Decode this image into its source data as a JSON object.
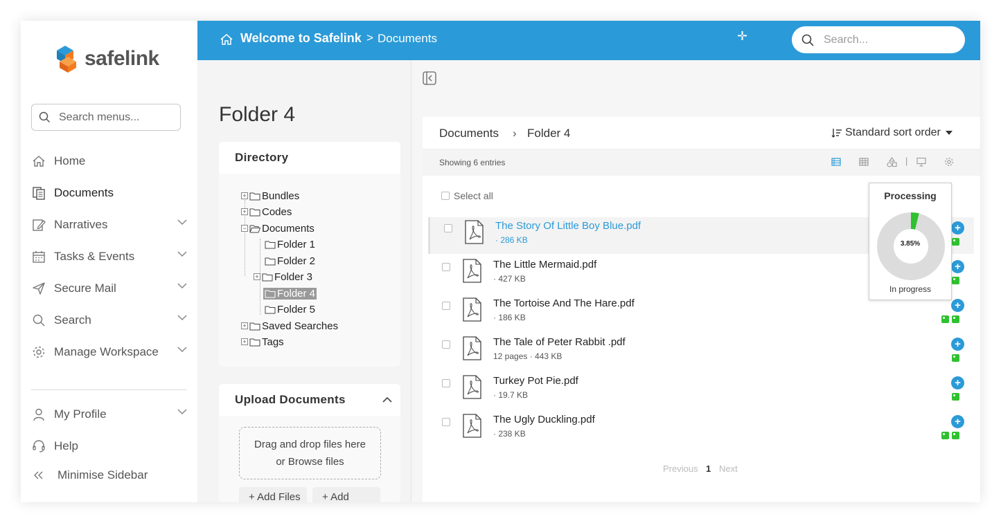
{
  "app": {
    "brand": "safelink"
  },
  "sidebar": {
    "search_placeholder": "Search menus...",
    "items": [
      {
        "label": "Home",
        "icon": "home-icon"
      },
      {
        "label": "Documents",
        "icon": "documents-icon"
      },
      {
        "label": "Narratives",
        "icon": "narratives-icon"
      },
      {
        "label": "Tasks & Events",
        "icon": "calendar-icon"
      },
      {
        "label": "Secure Mail",
        "icon": "paper-plane-icon"
      },
      {
        "label": "Search",
        "icon": "search-icon"
      },
      {
        "label": "Manage Workspace",
        "icon": "gear-icon"
      }
    ],
    "bottom_items": [
      {
        "label": "My Profile",
        "icon": "user-icon"
      },
      {
        "label": "Help",
        "icon": "headset-icon"
      },
      {
        "label": "Minimise Sidebar",
        "icon": "double-chevron-left-icon"
      }
    ]
  },
  "topbar": {
    "title": "Welcome to Safelink",
    "separator": ">",
    "crumb": "Documents",
    "search_placeholder": "Search...",
    "accent": "#2b9ad8"
  },
  "folder_title": "Folder 4",
  "directory": {
    "heading": "Directory",
    "nodes": [
      {
        "label": "Bundles"
      },
      {
        "label": "Codes"
      },
      {
        "label": "Documents"
      },
      {
        "label": "Folder 1"
      },
      {
        "label": "Folder 2"
      },
      {
        "label": "Folder 3"
      },
      {
        "label": "Folder 4"
      },
      {
        "label": "Folder 5"
      },
      {
        "label": "Saved Searches"
      },
      {
        "label": "Tags"
      }
    ]
  },
  "upload": {
    "heading": "Upload Documents",
    "dropzone_line1": "Drag and drop files here",
    "dropzone_line2": "or Browse files",
    "add_files": "+  Add Files",
    "add_folder": "+  Add Folder"
  },
  "main": {
    "breadcrumb_root": "Documents",
    "breadcrumb_sep": "›",
    "breadcrumb_current": "Folder 4",
    "sort_label": "Standard sort order",
    "showing_prefix": "Showing ",
    "showing_count": "6",
    "showing_suffix": " entries",
    "select_all": "Select all",
    "files": [
      {
        "name": "The Story Of Little Boy Blue.pdf",
        "meta": "· 286 KB"
      },
      {
        "name": "The Little Mermaid.pdf",
        "meta": "· 427 KB"
      },
      {
        "name": "The Tortoise And The Hare.pdf",
        "meta": "· 186 KB"
      },
      {
        "name": "The Tale of Peter Rabbit .pdf",
        "meta": "12 pages · 443 KB"
      },
      {
        "name": "Turkey Pot Pie.pdf",
        "meta": "· 19.7 KB"
      },
      {
        "name": "The Ugly Duckling.pdf",
        "meta": "· 238 KB"
      }
    ],
    "pager": {
      "previous": "Previous",
      "page": "1",
      "next": "Next"
    }
  },
  "processing": {
    "title": "Processing",
    "percent_label": "3.85%",
    "progress_fraction": 0.0385,
    "status": "In progress",
    "progress_color": "#2fc12f",
    "track_color": "#dcdcdc"
  }
}
